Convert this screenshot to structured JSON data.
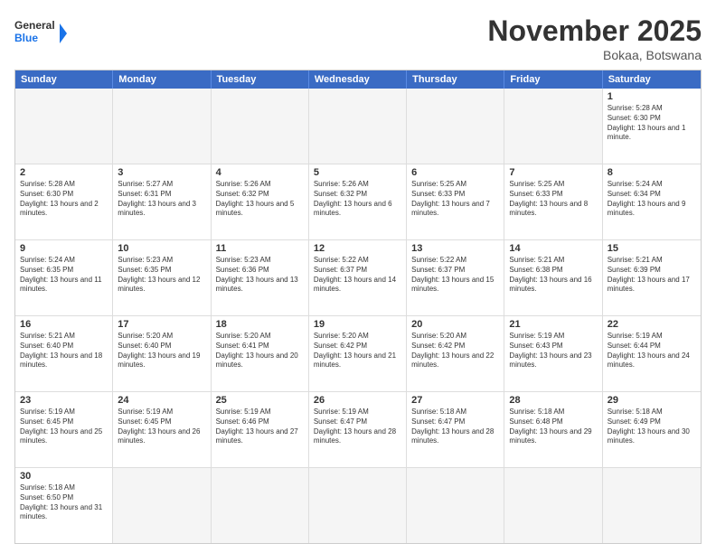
{
  "header": {
    "logo_general": "General",
    "logo_blue": "Blue",
    "month_title": "November 2025",
    "location": "Bokaa, Botswana"
  },
  "weekdays": [
    "Sunday",
    "Monday",
    "Tuesday",
    "Wednesday",
    "Thursday",
    "Friday",
    "Saturday"
  ],
  "rows": [
    [
      {
        "day": "",
        "text": ""
      },
      {
        "day": "",
        "text": ""
      },
      {
        "day": "",
        "text": ""
      },
      {
        "day": "",
        "text": ""
      },
      {
        "day": "",
        "text": ""
      },
      {
        "day": "",
        "text": ""
      },
      {
        "day": "1",
        "text": "Sunrise: 5:28 AM\nSunset: 6:30 PM\nDaylight: 13 hours and 1 minute."
      }
    ],
    [
      {
        "day": "2",
        "text": "Sunrise: 5:28 AM\nSunset: 6:30 PM\nDaylight: 13 hours and 2 minutes."
      },
      {
        "day": "3",
        "text": "Sunrise: 5:27 AM\nSunset: 6:31 PM\nDaylight: 13 hours and 3 minutes."
      },
      {
        "day": "4",
        "text": "Sunrise: 5:26 AM\nSunset: 6:32 PM\nDaylight: 13 hours and 5 minutes."
      },
      {
        "day": "5",
        "text": "Sunrise: 5:26 AM\nSunset: 6:32 PM\nDaylight: 13 hours and 6 minutes."
      },
      {
        "day": "6",
        "text": "Sunrise: 5:25 AM\nSunset: 6:33 PM\nDaylight: 13 hours and 7 minutes."
      },
      {
        "day": "7",
        "text": "Sunrise: 5:25 AM\nSunset: 6:33 PM\nDaylight: 13 hours and 8 minutes."
      },
      {
        "day": "8",
        "text": "Sunrise: 5:24 AM\nSunset: 6:34 PM\nDaylight: 13 hours and 9 minutes."
      }
    ],
    [
      {
        "day": "9",
        "text": "Sunrise: 5:24 AM\nSunset: 6:35 PM\nDaylight: 13 hours and 11 minutes."
      },
      {
        "day": "10",
        "text": "Sunrise: 5:23 AM\nSunset: 6:35 PM\nDaylight: 13 hours and 12 minutes."
      },
      {
        "day": "11",
        "text": "Sunrise: 5:23 AM\nSunset: 6:36 PM\nDaylight: 13 hours and 13 minutes."
      },
      {
        "day": "12",
        "text": "Sunrise: 5:22 AM\nSunset: 6:37 PM\nDaylight: 13 hours and 14 minutes."
      },
      {
        "day": "13",
        "text": "Sunrise: 5:22 AM\nSunset: 6:37 PM\nDaylight: 13 hours and 15 minutes."
      },
      {
        "day": "14",
        "text": "Sunrise: 5:21 AM\nSunset: 6:38 PM\nDaylight: 13 hours and 16 minutes."
      },
      {
        "day": "15",
        "text": "Sunrise: 5:21 AM\nSunset: 6:39 PM\nDaylight: 13 hours and 17 minutes."
      }
    ],
    [
      {
        "day": "16",
        "text": "Sunrise: 5:21 AM\nSunset: 6:40 PM\nDaylight: 13 hours and 18 minutes."
      },
      {
        "day": "17",
        "text": "Sunrise: 5:20 AM\nSunset: 6:40 PM\nDaylight: 13 hours and 19 minutes."
      },
      {
        "day": "18",
        "text": "Sunrise: 5:20 AM\nSunset: 6:41 PM\nDaylight: 13 hours and 20 minutes."
      },
      {
        "day": "19",
        "text": "Sunrise: 5:20 AM\nSunset: 6:42 PM\nDaylight: 13 hours and 21 minutes."
      },
      {
        "day": "20",
        "text": "Sunrise: 5:20 AM\nSunset: 6:42 PM\nDaylight: 13 hours and 22 minutes."
      },
      {
        "day": "21",
        "text": "Sunrise: 5:19 AM\nSunset: 6:43 PM\nDaylight: 13 hours and 23 minutes."
      },
      {
        "day": "22",
        "text": "Sunrise: 5:19 AM\nSunset: 6:44 PM\nDaylight: 13 hours and 24 minutes."
      }
    ],
    [
      {
        "day": "23",
        "text": "Sunrise: 5:19 AM\nSunset: 6:45 PM\nDaylight: 13 hours and 25 minutes."
      },
      {
        "day": "24",
        "text": "Sunrise: 5:19 AM\nSunset: 6:45 PM\nDaylight: 13 hours and 26 minutes."
      },
      {
        "day": "25",
        "text": "Sunrise: 5:19 AM\nSunset: 6:46 PM\nDaylight: 13 hours and 27 minutes."
      },
      {
        "day": "26",
        "text": "Sunrise: 5:19 AM\nSunset: 6:47 PM\nDaylight: 13 hours and 28 minutes."
      },
      {
        "day": "27",
        "text": "Sunrise: 5:18 AM\nSunset: 6:47 PM\nDaylight: 13 hours and 28 minutes."
      },
      {
        "day": "28",
        "text": "Sunrise: 5:18 AM\nSunset: 6:48 PM\nDaylight: 13 hours and 29 minutes."
      },
      {
        "day": "29",
        "text": "Sunrise: 5:18 AM\nSunset: 6:49 PM\nDaylight: 13 hours and 30 minutes."
      }
    ],
    [
      {
        "day": "30",
        "text": "Sunrise: 5:18 AM\nSunset: 6:50 PM\nDaylight: 13 hours and 31 minutes."
      },
      {
        "day": "",
        "text": ""
      },
      {
        "day": "",
        "text": ""
      },
      {
        "day": "",
        "text": ""
      },
      {
        "day": "",
        "text": ""
      },
      {
        "day": "",
        "text": ""
      },
      {
        "day": "",
        "text": ""
      }
    ]
  ]
}
